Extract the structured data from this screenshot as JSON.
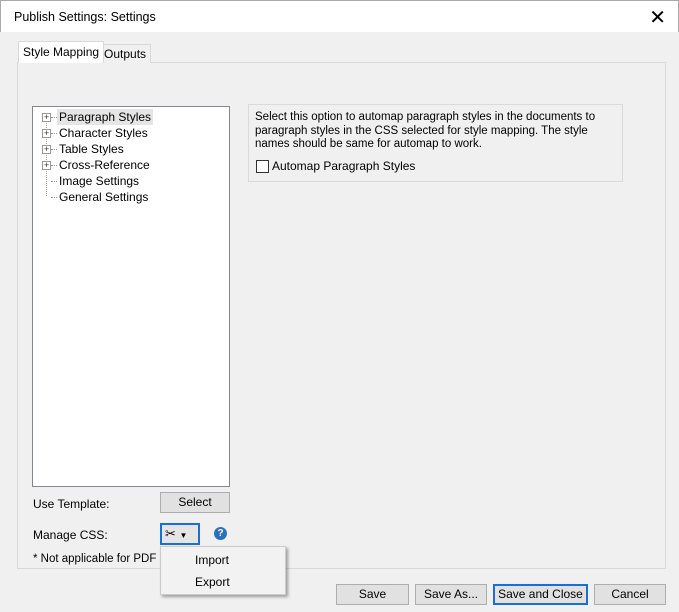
{
  "window": {
    "title": "Publish Settings: Settings"
  },
  "tabs": [
    {
      "label": "Style Mapping",
      "active": true
    },
    {
      "label": "Outputs",
      "active": false
    }
  ],
  "tree": {
    "items": [
      {
        "label": "Paragraph Styles",
        "expandable": true,
        "selected": true
      },
      {
        "label": "Character Styles",
        "expandable": true
      },
      {
        "label": "Table Styles",
        "expandable": true
      },
      {
        "label": "Cross-Reference",
        "expandable": true
      },
      {
        "label": "Image Settings",
        "expandable": false
      },
      {
        "label": "General Settings",
        "expandable": false
      }
    ]
  },
  "info": {
    "description": "Select this option to automap paragraph styles in the documents to paragraph styles in the CSS selected for style mapping. The style names should be same for automap to work.",
    "checkbox_label": "Automap Paragraph Styles",
    "checked": false
  },
  "template": {
    "label": "Use Template:",
    "button": "Select"
  },
  "css": {
    "label": "Manage CSS:",
    "note": "* Not applicable for PDF ou"
  },
  "menu": {
    "items": [
      "Import",
      "Export"
    ]
  },
  "footer": {
    "save": "Save",
    "save_as": "Save As...",
    "save_close": "Save and Close",
    "cancel": "Cancel"
  }
}
